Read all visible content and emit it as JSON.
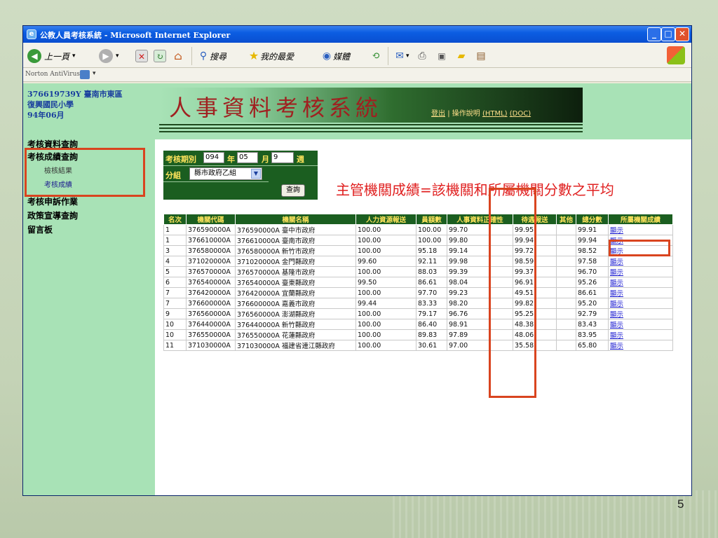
{
  "window": {
    "title": "公教人員考核系統 - Microsoft Internet Explorer"
  },
  "toolbar": {
    "back_label": "上一頁",
    "search_label": "搜尋",
    "favorites_label": "我的最愛",
    "media_label": "媒體"
  },
  "norton": {
    "label": "Norton AntiVirus"
  },
  "sidebar": {
    "org_line1": "376619739Y 臺南市東區",
    "org_line2": "復興國民小學",
    "period": "94年06月",
    "menu": [
      "考核資料查詢",
      "考核成績查詢",
      "考核申訴作業",
      "政策宣導查詢",
      "留言板"
    ],
    "submenu": [
      "檢核結果",
      "考核成績"
    ]
  },
  "banner": {
    "title": "人事資料考核系統",
    "logout": "登出",
    "separator": " | ",
    "help_prefix": "操作說明",
    "help_html": "(HTML)",
    "help_doc": "(DOC)"
  },
  "form": {
    "period_label": "考核期別",
    "year_value": "094",
    "year_unit": "年",
    "month_value": "05",
    "month_unit": "月",
    "week_value": "9",
    "week_unit": "週",
    "group_label": "分組",
    "group_value": "縣市政府乙組",
    "query_button": "查詢"
  },
  "note": "主管機關成績=該機關和所屬機關分數之平均",
  "table": {
    "headers": [
      "名次",
      "機關代碼",
      "機關名稱",
      "人力資源報送",
      "員額數",
      "人事資料正確性",
      "待遇報送",
      "其他",
      "總分數",
      "所屬機關成績"
    ],
    "link_text": "顯示",
    "rows": [
      [
        "1",
        "376590000A",
        "376590000A 臺中市政府",
        "100.00",
        "100.00",
        "99.70",
        "99.95",
        "",
        "99.91"
      ],
      [
        "1",
        "376610000A",
        "376610000A 臺南市政府",
        "100.00",
        "100.00",
        "99.80",
        "99.94",
        "",
        "99.94"
      ],
      [
        "3",
        "376580000A",
        "376580000A 新竹市政府",
        "100.00",
        "95.18",
        "99.14",
        "99.72",
        "",
        "98.52"
      ],
      [
        "4",
        "371020000A",
        "371020000A 金門縣政府",
        "99.60",
        "92.11",
        "99.98",
        "98.59",
        "",
        "97.58"
      ],
      [
        "5",
        "376570000A",
        "376570000A 基隆市政府",
        "100.00",
        "88.03",
        "99.39",
        "99.37",
        "",
        "96.70"
      ],
      [
        "6",
        "376540000A",
        "376540000A 臺東縣政府",
        "99.50",
        "86.61",
        "98.04",
        "96.91",
        "",
        "95.26"
      ],
      [
        "7",
        "376420000A",
        "376420000A 宜蘭縣政府",
        "100.00",
        "97.70",
        "99.23",
        "49.51",
        "",
        "86.61"
      ],
      [
        "7",
        "376600000A",
        "376600000A 嘉義市政府",
        "99.44",
        "83.33",
        "98.20",
        "99.82",
        "",
        "95.20"
      ],
      [
        "9",
        "376560000A",
        "376560000A 澎湖縣政府",
        "100.00",
        "79.17",
        "96.76",
        "95.25",
        "",
        "92.79"
      ],
      [
        "10",
        "376440000A",
        "376440000A 新竹縣政府",
        "100.00",
        "86.40",
        "98.91",
        "48.38",
        "",
        "83.43"
      ],
      [
        "10",
        "376550000A",
        "376550000A 花蓮縣政府",
        "100.00",
        "89.83",
        "97.89",
        "48.06",
        "",
        "83.95"
      ],
      [
        "11",
        "371030000A",
        "371030000A 福建省連江縣政府",
        "100.00",
        "30.61",
        "97.00",
        "35.58",
        "",
        "65.80"
      ]
    ]
  },
  "slide": {
    "number": "5"
  }
}
